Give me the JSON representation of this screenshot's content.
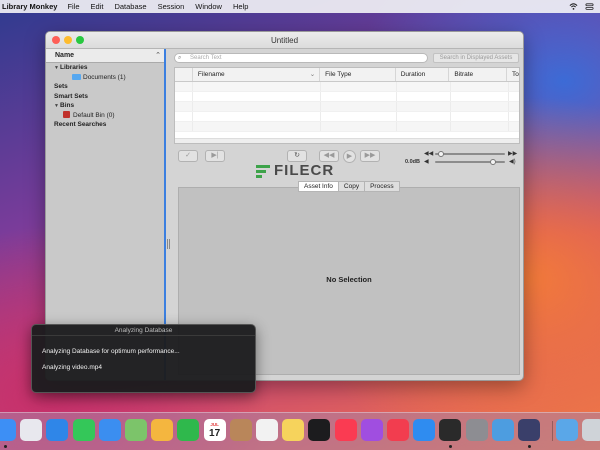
{
  "menubar": {
    "app_name": "Library Monkey",
    "items": [
      "File",
      "Edit",
      "Database",
      "Session",
      "Window",
      "Help"
    ]
  },
  "window": {
    "title": "Untitled"
  },
  "sidebar": {
    "header": "Name",
    "items": [
      {
        "label": "Libraries",
        "level": 0,
        "bold": true,
        "expandable": true
      },
      {
        "label": "Documents (1)",
        "level": 2,
        "bold": false,
        "icon": "folder-icon"
      },
      {
        "label": "Sets",
        "level": 0,
        "bold": true
      },
      {
        "label": "Smart Sets",
        "level": 0,
        "bold": true
      },
      {
        "label": "Bins",
        "level": 0,
        "bold": true,
        "expandable": true
      },
      {
        "label": "Default Bin (0)",
        "level": 1,
        "bold": false,
        "icon": "bin-icon"
      },
      {
        "label": "Recent Searches",
        "level": 0,
        "bold": true
      }
    ]
  },
  "search": {
    "placeholder": "Search Text",
    "assets_button": "Search in Displayed Assets"
  },
  "table": {
    "columns": [
      "Filename",
      "File Type",
      "Duration",
      "Bitrate",
      "To"
    ],
    "rows": []
  },
  "controls": {
    "time_label": "0.0dB"
  },
  "watermark": {
    "text": "FILECR"
  },
  "tabs": [
    "Asset Info",
    "Copy",
    "Process"
  ],
  "detail": {
    "empty_text": "No Selection"
  },
  "analyze_panel": {
    "title": "Analyzing Database",
    "line1": "Analyzing Database for optimum performance...",
    "line2": "Analyzing video.mp4"
  },
  "dock": {
    "calendar_month": "JUL",
    "calendar_day": "17",
    "apps": [
      {
        "name": "finder-icon",
        "color": "#3d8ff5"
      },
      {
        "name": "launchpad-icon",
        "color": "#e8e8ee"
      },
      {
        "name": "safari-icon",
        "color": "#2f86e8"
      },
      {
        "name": "messages-icon",
        "color": "#34c759"
      },
      {
        "name": "mail-icon",
        "color": "#3b8ef0"
      },
      {
        "name": "maps-icon",
        "color": "#7cc46a"
      },
      {
        "name": "photos-icon",
        "color": "#f4b63f"
      },
      {
        "name": "facetime-icon",
        "color": "#2fb84c"
      },
      {
        "name": "calendar-icon",
        "color": "#ffffff"
      },
      {
        "name": "contacts-icon",
        "color": "#b9865a"
      },
      {
        "name": "reminders-icon",
        "color": "#f2f2f2"
      },
      {
        "name": "notes-icon",
        "color": "#f6d35c"
      },
      {
        "name": "appletv-icon",
        "color": "#1c1c1e"
      },
      {
        "name": "music-icon",
        "color": "#fa3b52"
      },
      {
        "name": "podcasts-icon",
        "color": "#a04ee0"
      },
      {
        "name": "news-icon",
        "color": "#f23d4f"
      },
      {
        "name": "appstore-icon",
        "color": "#2f8cf0"
      },
      {
        "name": "terminal-icon",
        "color": "#2a2a2a"
      },
      {
        "name": "system-preferences-icon",
        "color": "#8d8d92"
      },
      {
        "name": "altool-icon",
        "color": "#4d9de0"
      },
      {
        "name": "library-monkey-icon",
        "color": "#3a3f6a"
      },
      {
        "name": "downloads-folder-icon",
        "color": "#5aa7e8"
      },
      {
        "name": "trash-icon",
        "color": "#cfd3d8"
      }
    ]
  }
}
